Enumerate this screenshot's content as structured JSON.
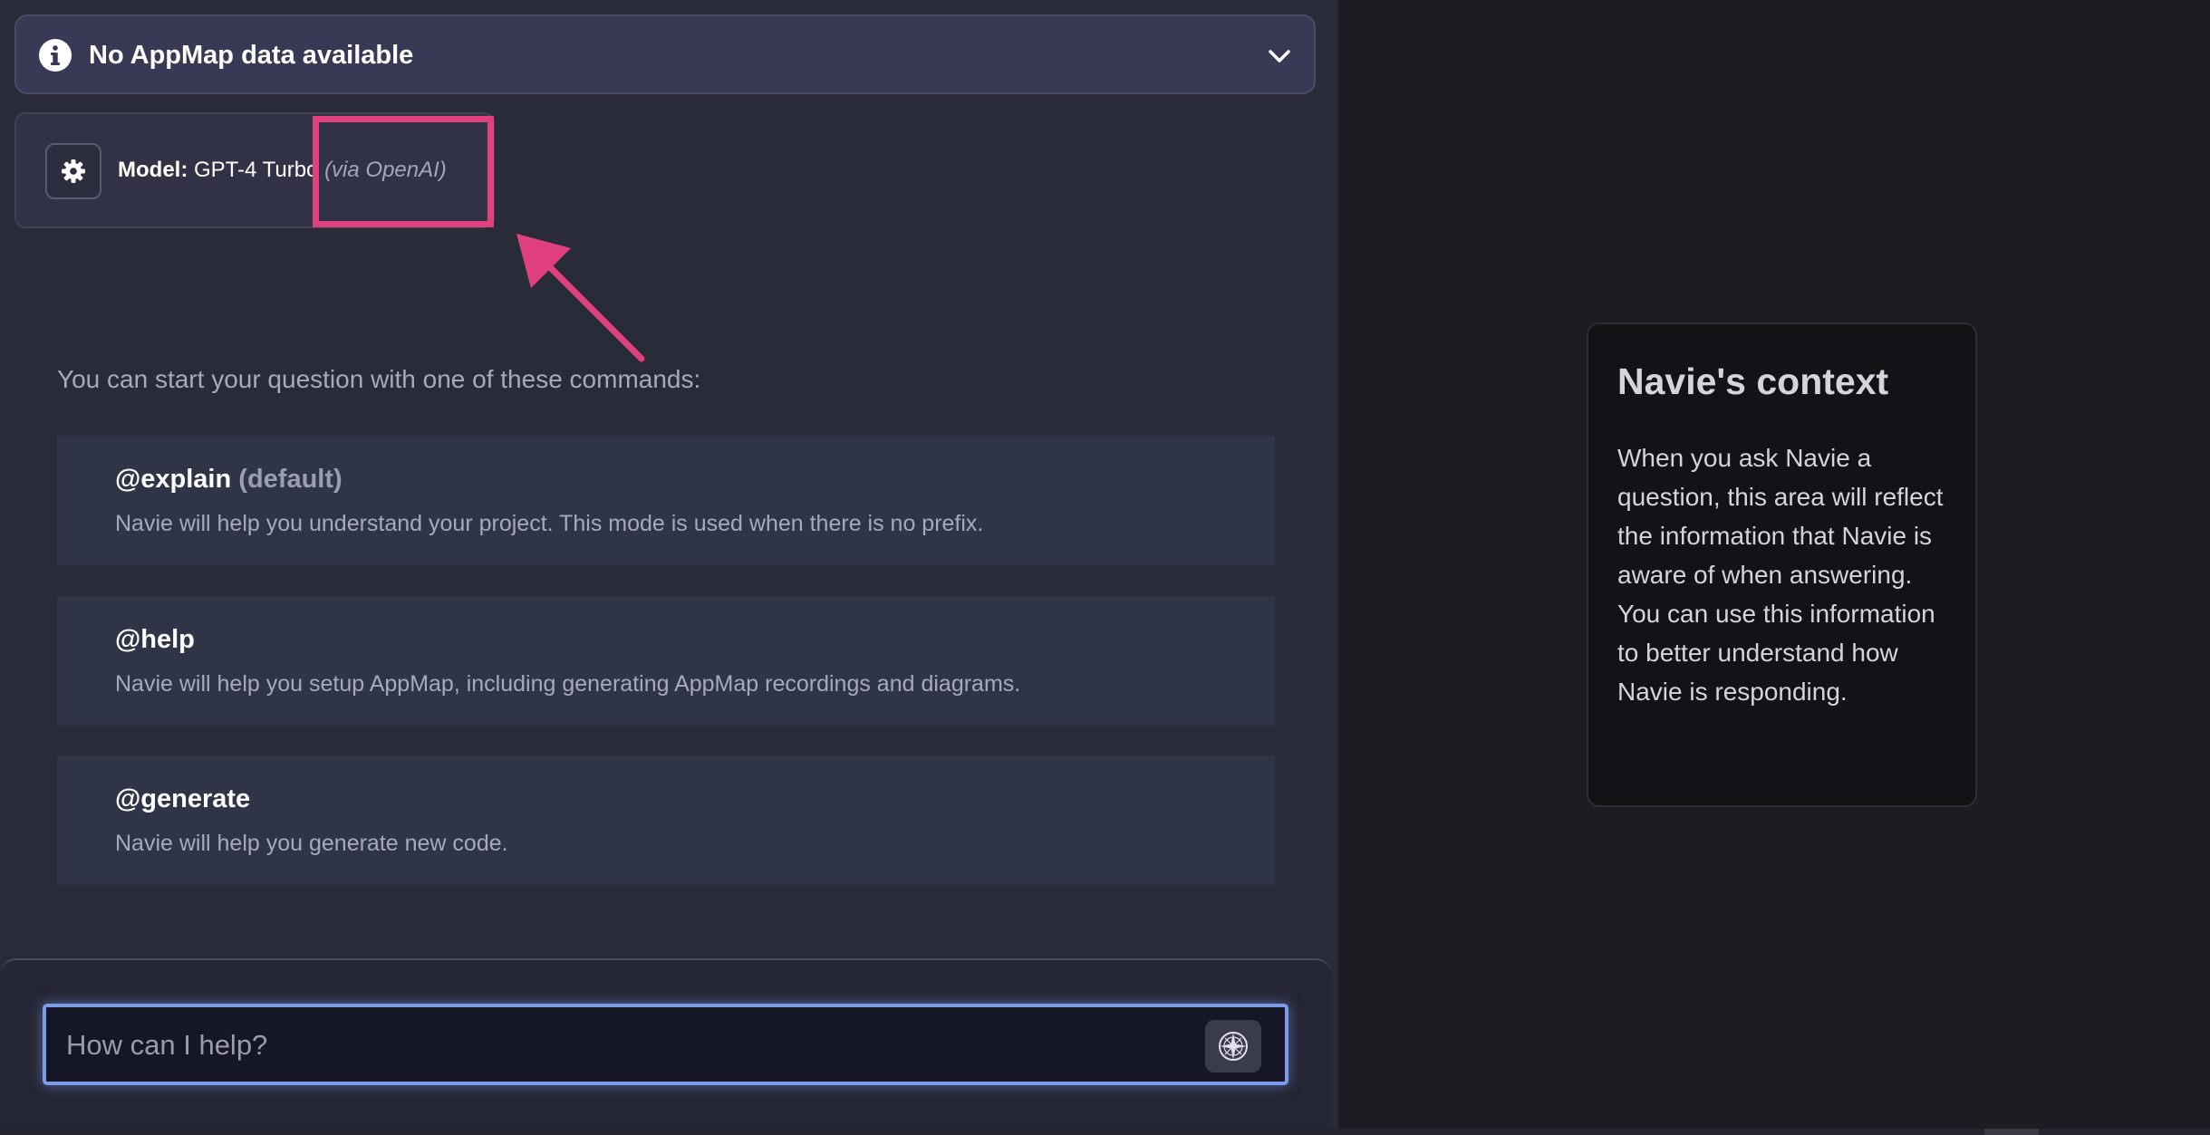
{
  "appmap_banner": {
    "title": "No AppMap data available"
  },
  "model": {
    "label": "Model:",
    "name": "GPT-4 Turbo",
    "provider": "(via OpenAI)"
  },
  "commands_intro": "You can start your question with one of these commands:",
  "commands": [
    {
      "name": "@explain",
      "tag": "(default)",
      "description": "Navie will help you understand your project. This mode is used when there is no prefix."
    },
    {
      "name": "@help",
      "tag": "",
      "description": "Navie will help you setup AppMap, including generating AppMap recordings and diagrams."
    },
    {
      "name": "@generate",
      "tag": "",
      "description": "Navie will help you generate new code."
    }
  ],
  "input": {
    "placeholder": "How can I help?",
    "value": ""
  },
  "context": {
    "title": "Navie's context",
    "body": "When you ask Navie a question, this area will reflect the information that Navie is aware of when answering. You can use this information to better understand how Navie is responding."
  },
  "colors": {
    "annotation": "#e0407d",
    "input_border": "#7b9be6",
    "left_bg": "#2a2b39",
    "right_bg": "#1c1d22"
  },
  "icons": {
    "info": "info-circle-icon",
    "chevron": "chevron-down-icon",
    "settings": "gear-icon",
    "compass": "compass-icon"
  }
}
